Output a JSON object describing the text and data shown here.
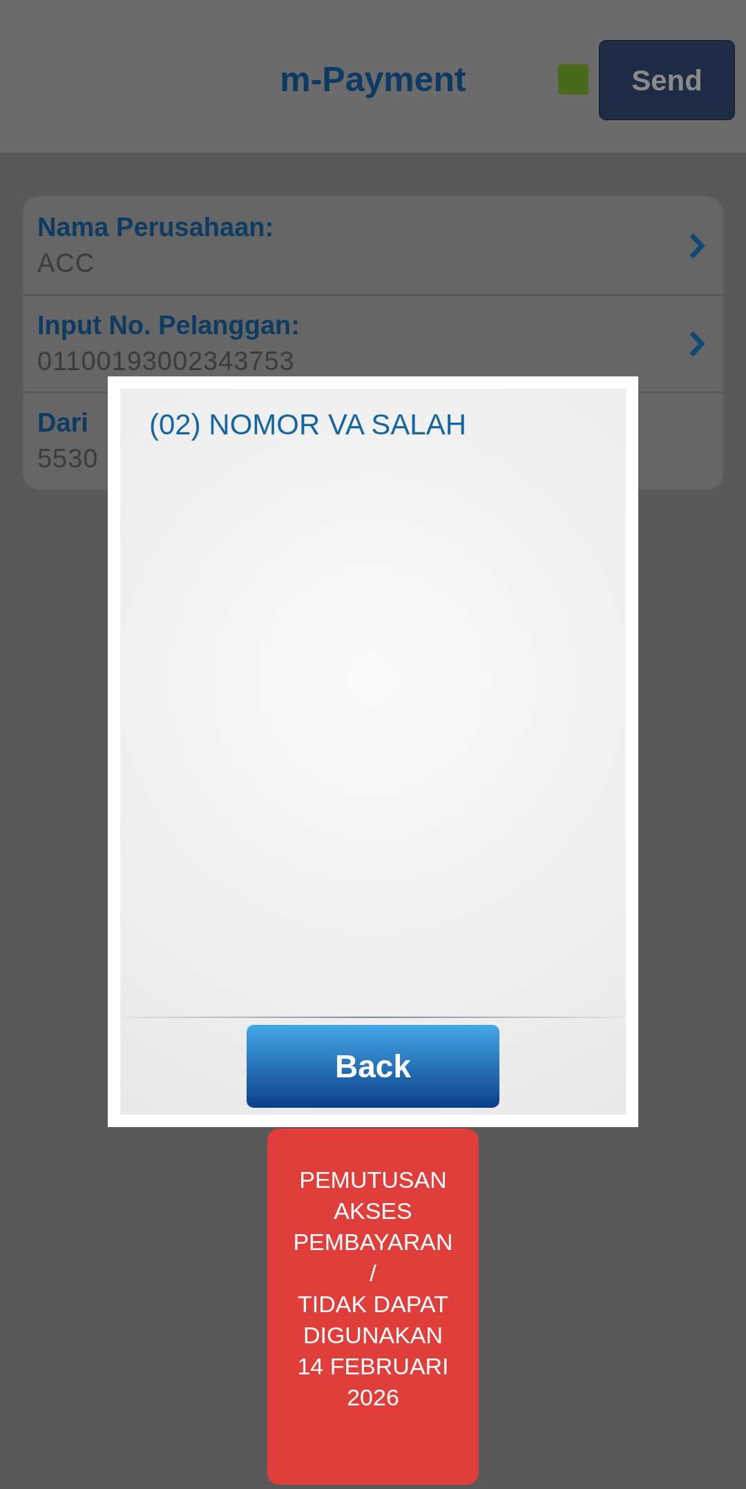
{
  "header": {
    "title": "m-Payment",
    "send_button": "Send"
  },
  "form": {
    "rows": [
      {
        "label": "Nama Perusahaan:",
        "value": "ACC",
        "chevron": true
      },
      {
        "label": "Input No. Pelanggan:",
        "value": "01100193002343753",
        "chevron": true
      },
      {
        "label": "Dari",
        "value": "5530",
        "chevron": false
      }
    ]
  },
  "dialog": {
    "message": "(02) NOMOR VA SALAH",
    "button": "Back"
  },
  "notice": {
    "text": "PEMUTUSAN\nAKSES\nPEMBAYARAN\n/\nTIDAK DAPAT\nDIGUNAKAN\n14 FEBRUARI\n2026"
  }
}
